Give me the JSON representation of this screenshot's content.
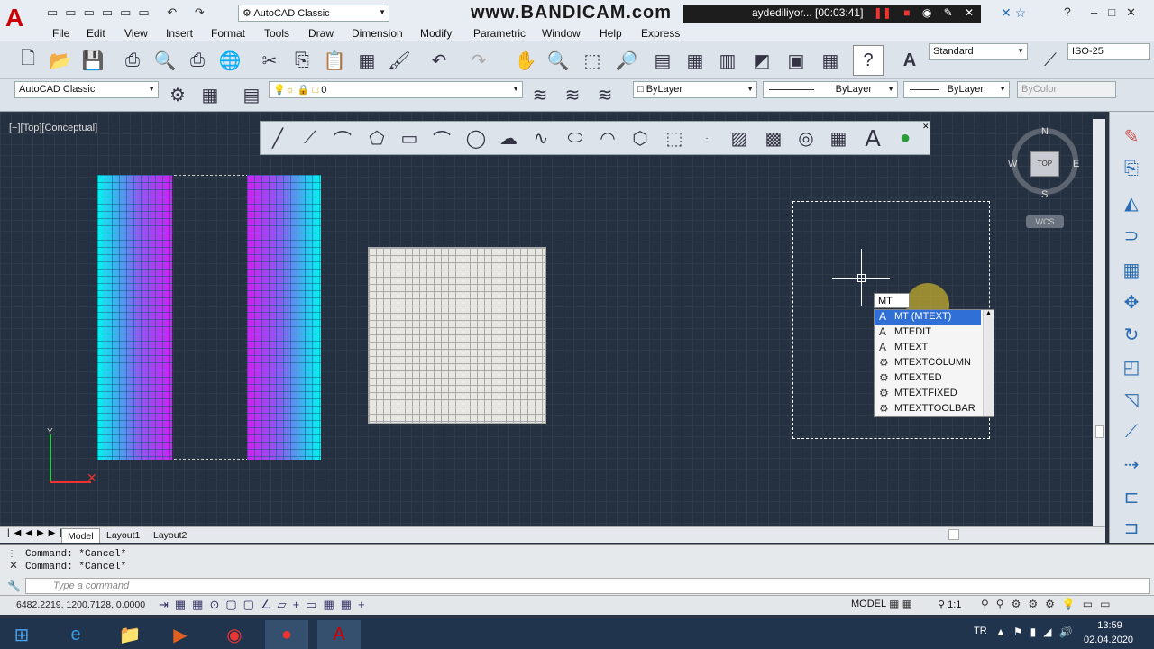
{
  "title_bar": {
    "workspace": "AutoCAD Classic",
    "watermark": "www.BANDICAM.com",
    "recording_label": "aydediliyor... [00:03:41]"
  },
  "menu": {
    "items": [
      "File",
      "Edit",
      "View",
      "Insert",
      "Format",
      "Tools",
      "Draw",
      "Dimension",
      "Modify",
      "Parametric",
      "Window",
      "Help",
      "Express"
    ]
  },
  "toolbar": {
    "text_style": "Standard",
    "dim_style": "ISO-25",
    "workspace_combo": "AutoCAD Classic",
    "layer": "0",
    "color": "ByLayer",
    "linetype": "ByLayer",
    "lineweight": "ByLayer",
    "plotstyle": "ByColor"
  },
  "viewport": {
    "label": "[−][Top][Conceptual]"
  },
  "viewcube": {
    "north": "N",
    "south": "S",
    "east": "E",
    "west": "W",
    "top": "TOP",
    "wcs": "WCS"
  },
  "ucs": {
    "y": "Y"
  },
  "autocomplete": {
    "typed": "MT",
    "items": [
      "MT (MTEXT)",
      "MTEDIT",
      "MTEXT",
      "MTEXTCOLUMN",
      "MTEXTED",
      "MTEXTFIXED",
      "MTEXTTOOLBAR"
    ],
    "selected_index": 0
  },
  "layout_tabs": [
    "Model",
    "Layout1",
    "Layout2"
  ],
  "command_history": [
    "Command: *Cancel*",
    "Command: *Cancel*"
  ],
  "command_placeholder": "Type a command",
  "status": {
    "coordinates": "6482.2219, 1200.7128, 0.0000",
    "space": "MODEL",
    "scale": "1:1"
  },
  "taskbar": {
    "lang": "TR",
    "time": "13:59",
    "date": "02.04.2020"
  }
}
